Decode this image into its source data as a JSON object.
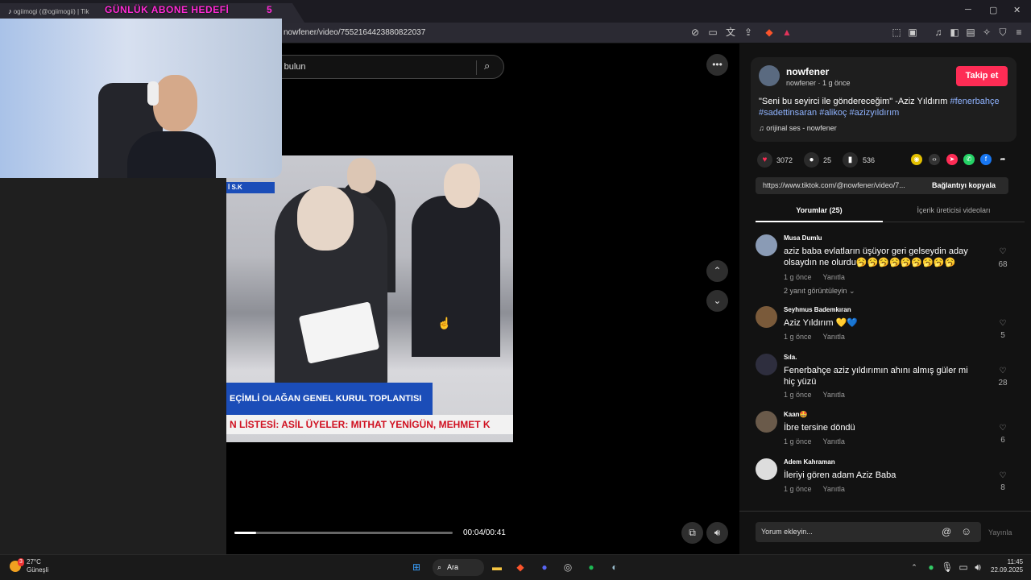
{
  "window": {
    "tab_title": "ogiimogi (@ogiimogii) | Tik",
    "overlay_text": "GÜNLÜK ABONE HEDEFİ",
    "overlay_count": "5",
    "minimize": "─",
    "maximize": "▢",
    "close": "✕"
  },
  "browser": {
    "url": "nowfener/video/7552164423880822037"
  },
  "search": {
    "placeholder": "gi bulun"
  },
  "video": {
    "banner_small": "İ S.K",
    "banner_main": "EÇİMLİ OLAĞAN GENEL KURUL TOPLANTISI",
    "banner_ticker": "N LİSTESİ: ASİL ÜYELER: MITHAT YENİGÜN, MEHMET K",
    "time": "00:04/00:41",
    "progress": 0.1,
    "more": "•••",
    "up": "⌃",
    "down": "⌄"
  },
  "post": {
    "username": "nowfener",
    "sub": "nowfener · 1 g önce",
    "follow": "Takip et",
    "caption": "\"Seni bu seyirci ile göndereceğim\" -Aziz Yıldırım",
    "tags": [
      "#fenerbahçe",
      "#sadettinsaran",
      "#alikoç",
      "#azizyıldırım"
    ],
    "music": "orijinal ses - nowfener",
    "likes": "3072",
    "comments": "25",
    "saves": "536",
    "link": "https://www.tiktok.com/@nowfener/video/7...",
    "copy": "Bağlantıyı kopyala",
    "tab_comments": "Yorumlar (25)",
    "tab_creator": "İçerik üreticisi videoları"
  },
  "comments": [
    {
      "name": "Musa Dumlu",
      "text": "aziz baba evlatların üşüyor geri gelseydin aday olsaydın ne olurdu🥱🥱🥱🥱🥱🥱🥱🥱🥱",
      "time": "1 g önce",
      "reply": "Yanıtla",
      "likes": "68",
      "extra": "2 yanıt görüntüleyin ⌄"
    },
    {
      "name": "Seyhmus Bademkıran",
      "text": "Aziz Yıldırım 💛💙",
      "time": "1 g önce",
      "reply": "Yanıtla",
      "likes": "5"
    },
    {
      "name": "Sıla.",
      "text": "Fenerbahçe aziz yıldırımın ahını almış güler mi hiç yüzü",
      "time": "1 g önce",
      "reply": "Yanıtla",
      "likes": "28"
    },
    {
      "name": "Kaan🤩",
      "text": "İbre tersine döndü",
      "time": "1 g önce",
      "reply": "Yanıtla",
      "likes": "6"
    },
    {
      "name": "Adem Kahraman",
      "text": "İleriyi gören adam Aziz Baba",
      "time": "1 g önce",
      "reply": "Yanıtla",
      "likes": "8"
    }
  ],
  "comment_box": {
    "placeholder": "Yorum ekleyin...",
    "mention": "@",
    "emoji": "☺",
    "publish": "Yayınla"
  },
  "taskbar": {
    "temp": "27°C",
    "weather": "Güneşli",
    "search": "Ara",
    "time": "11:45",
    "date": "22.09.2025",
    "badge": "3"
  }
}
